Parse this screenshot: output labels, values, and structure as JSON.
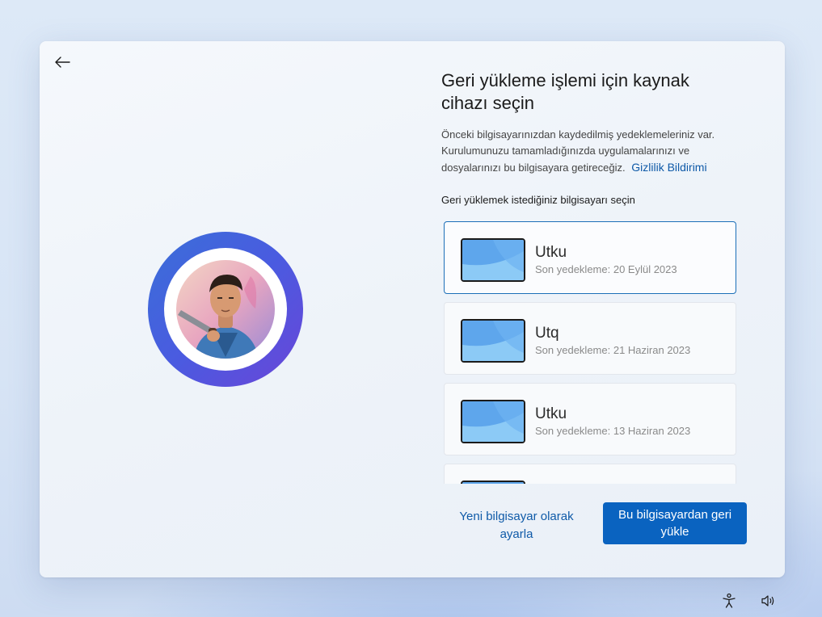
{
  "title": "Geri yükleme işlemi için kaynak cihazı seçin",
  "description": "Önceki bilgisayarınızdan kaydedilmiş yedeklemeleriniz var. Kurulumunuzu tamamladığınızda uygulamalarınızı ve dosyalarınızı bu bilgisayara getireceğiz.",
  "privacy_link": "Gizlilik Bildirimi",
  "subheading": "Geri yüklemek istediğiniz bilgisayarı seçin",
  "devices": [
    {
      "name": "Utku",
      "backup": "Son yedekleme: 20 Eylül 2023",
      "selected": true
    },
    {
      "name": "Utq",
      "backup": "Son yedekleme: 21 Haziran 2023",
      "selected": false
    },
    {
      "name": "Utku",
      "backup": "Son yedekleme: 13 Haziran 2023",
      "selected": false
    }
  ],
  "buttons": {
    "secondary": "Yeni bilgisayar olarak ayarla",
    "primary": "Bu bilgisayardan geri yükle"
  },
  "icons": {
    "back": "back-arrow-icon",
    "avatar": "user-avatar",
    "accessibility": "accessibility-icon",
    "volume": "volume-icon"
  },
  "colors": {
    "accent": "#0a63c0",
    "link": "#0f5aa8",
    "ring_start": "#3a6fd8",
    "ring_end": "#6a45d8"
  }
}
